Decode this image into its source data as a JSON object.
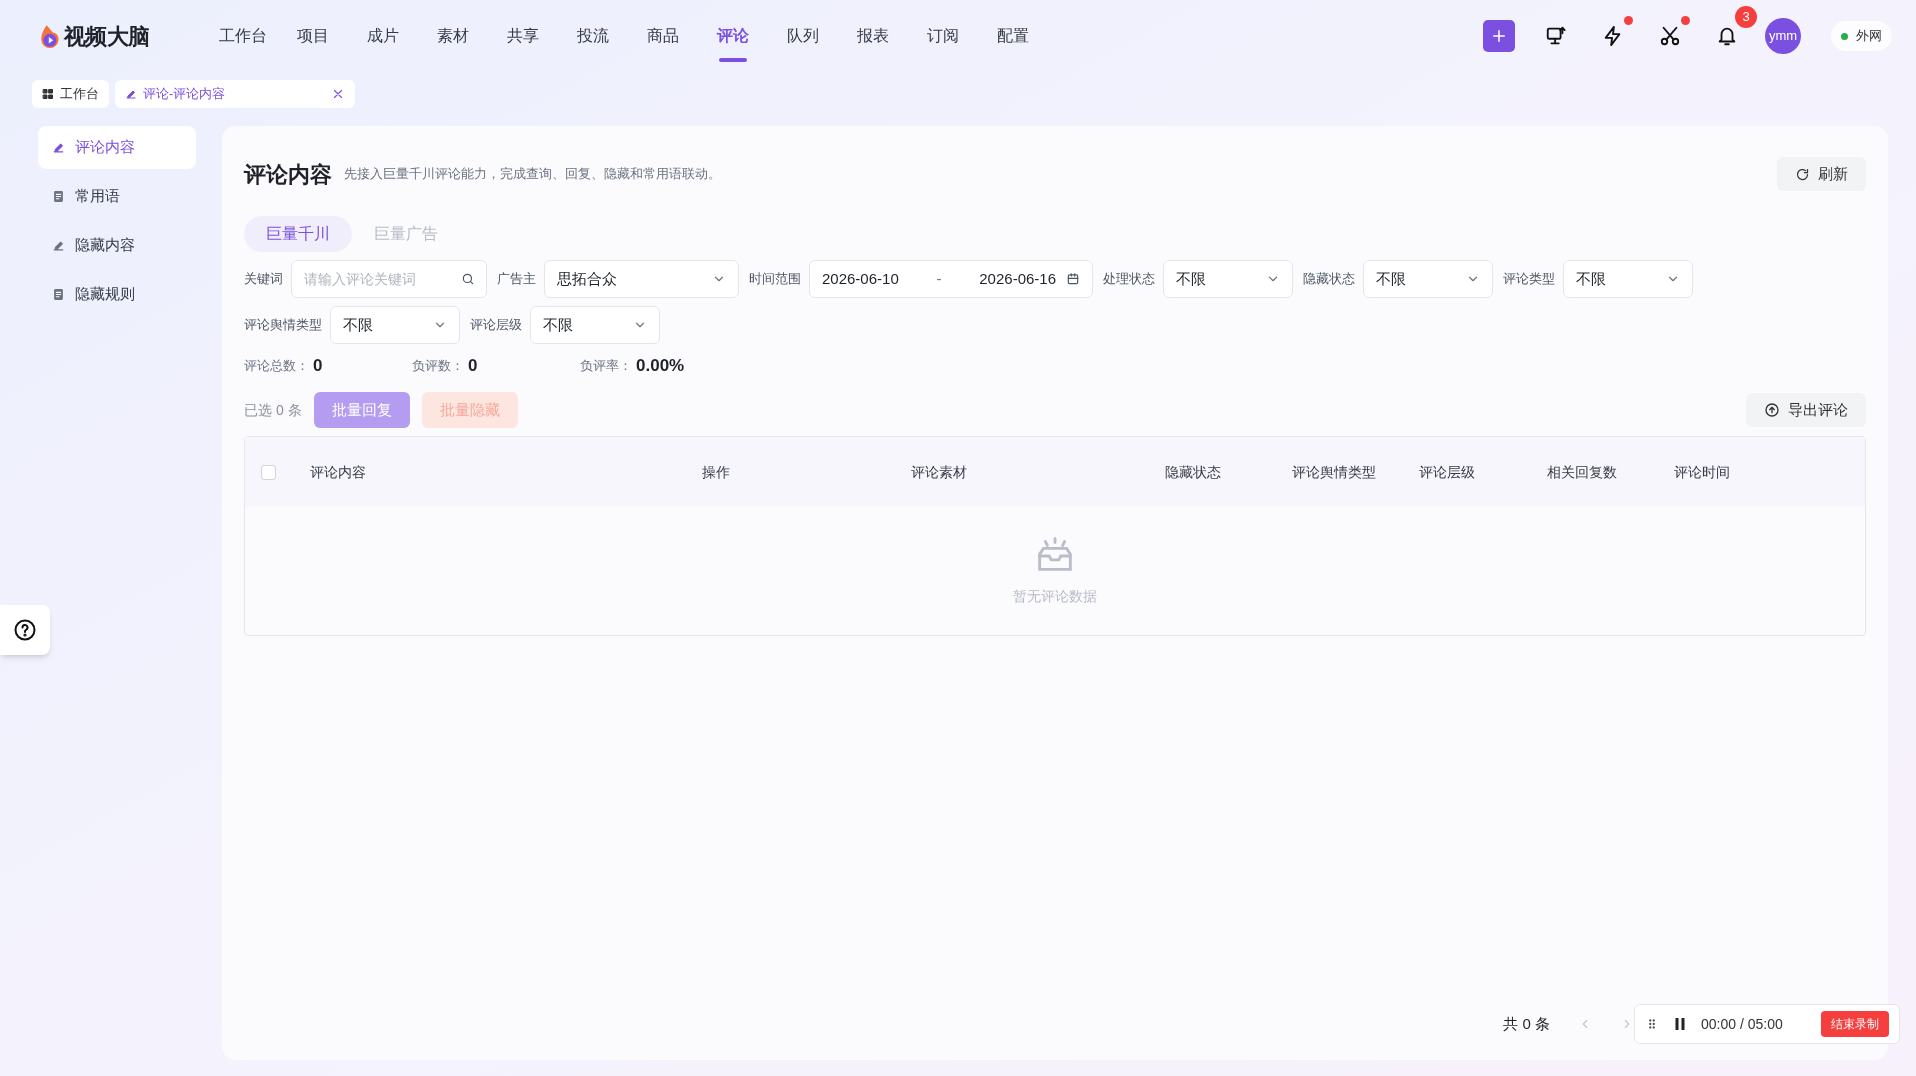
{
  "app": {
    "logo": "视频大脑"
  },
  "nav": [
    {
      "label": "工作台",
      "selected": false
    },
    {
      "label": "项目",
      "selected": false
    },
    {
      "label": "成片",
      "selected": false
    },
    {
      "label": "素材",
      "selected": false
    },
    {
      "label": "共享",
      "selected": false
    },
    {
      "label": "投流",
      "selected": false
    },
    {
      "label": "商品",
      "selected": false
    },
    {
      "label": "评论",
      "selected": true
    },
    {
      "label": "队列",
      "selected": false
    },
    {
      "label": "报表",
      "selected": false
    },
    {
      "label": "订阅",
      "selected": false
    },
    {
      "label": "配置",
      "selected": false
    }
  ],
  "header_icons": [
    {
      "kind": "monitor",
      "dot": false
    },
    {
      "kind": "bolt",
      "dot": true
    },
    {
      "kind": "scissors",
      "dot": true
    },
    {
      "kind": "bell",
      "dot": false,
      "badge": "3"
    }
  ],
  "user": {
    "avatar": "ymm",
    "network": "外网"
  },
  "page_tabs": [
    {
      "kind": "grid",
      "label": "工作台",
      "selected": false,
      "closable": false
    },
    {
      "kind": "edit",
      "label": "评论-评论内容",
      "selected": true,
      "closable": true
    }
  ],
  "sidebar": [
    {
      "kind": "edit",
      "label": "评论内容",
      "selected": true
    },
    {
      "kind": "doc",
      "label": "常用语",
      "selected": false
    },
    {
      "kind": "edit",
      "label": "隐藏内容",
      "selected": false
    },
    {
      "kind": "doc",
      "label": "隐藏规则",
      "selected": false
    }
  ],
  "content": {
    "title": "评论内容",
    "subtitle": "先接入巨量千川评论能力，完成查询、回复、隐藏和常用语联动。",
    "refresh": "刷新",
    "source_tabs": [
      {
        "label": "巨量千川",
        "selected": true
      },
      {
        "label": "巨量广告",
        "selected": false
      }
    ],
    "filter_rows": [
      [
        {
          "kind": "search",
          "label": "关键词",
          "placeholder": "请输入评论关键词"
        },
        {
          "kind": "select",
          "label": "广告主",
          "value": "思拓合众"
        },
        {
          "kind": "daterange",
          "label": "时间范围",
          "start": "2026-06-10",
          "separator": "-",
          "end": "2026-06-16"
        },
        {
          "kind": "select",
          "label": "处理状态",
          "value": "不限"
        },
        {
          "kind": "select",
          "label": "隐藏状态",
          "value": "不限"
        },
        {
          "kind": "select",
          "label": "评论类型",
          "value": "不限"
        }
      ],
      [
        {
          "kind": "select",
          "label": "评论舆情类型",
          "value": "不限"
        },
        {
          "kind": "select",
          "label": "评论层级",
          "value": "不限"
        }
      ]
    ],
    "stats": [
      {
        "label": "评论总数：",
        "value": "0"
      },
      {
        "label": "负评数：",
        "value": "0"
      },
      {
        "label": "负评率：",
        "value": "0.00%"
      }
    ],
    "selected_count": "已选 0 条",
    "batch_buttons": [
      {
        "kind": "primary",
        "label": "批量回复",
        "disabled": true
      },
      {
        "kind": "danger",
        "label": "批量隐藏",
        "disabled": true
      }
    ],
    "export": "导出评论",
    "table": {
      "select_all_checked": false,
      "columns": [
        "评论内容",
        "操作",
        "评论素材",
        "隐藏状态",
        "评论舆情类型",
        "评论层级",
        "相关回复数",
        "评论时间"
      ],
      "empty_text": "暂无评论数据"
    },
    "pagination": {
      "total": "共 0 条"
    }
  },
  "recorder": {
    "time": "00:00 / 05:00",
    "stop": "结束录制"
  }
}
